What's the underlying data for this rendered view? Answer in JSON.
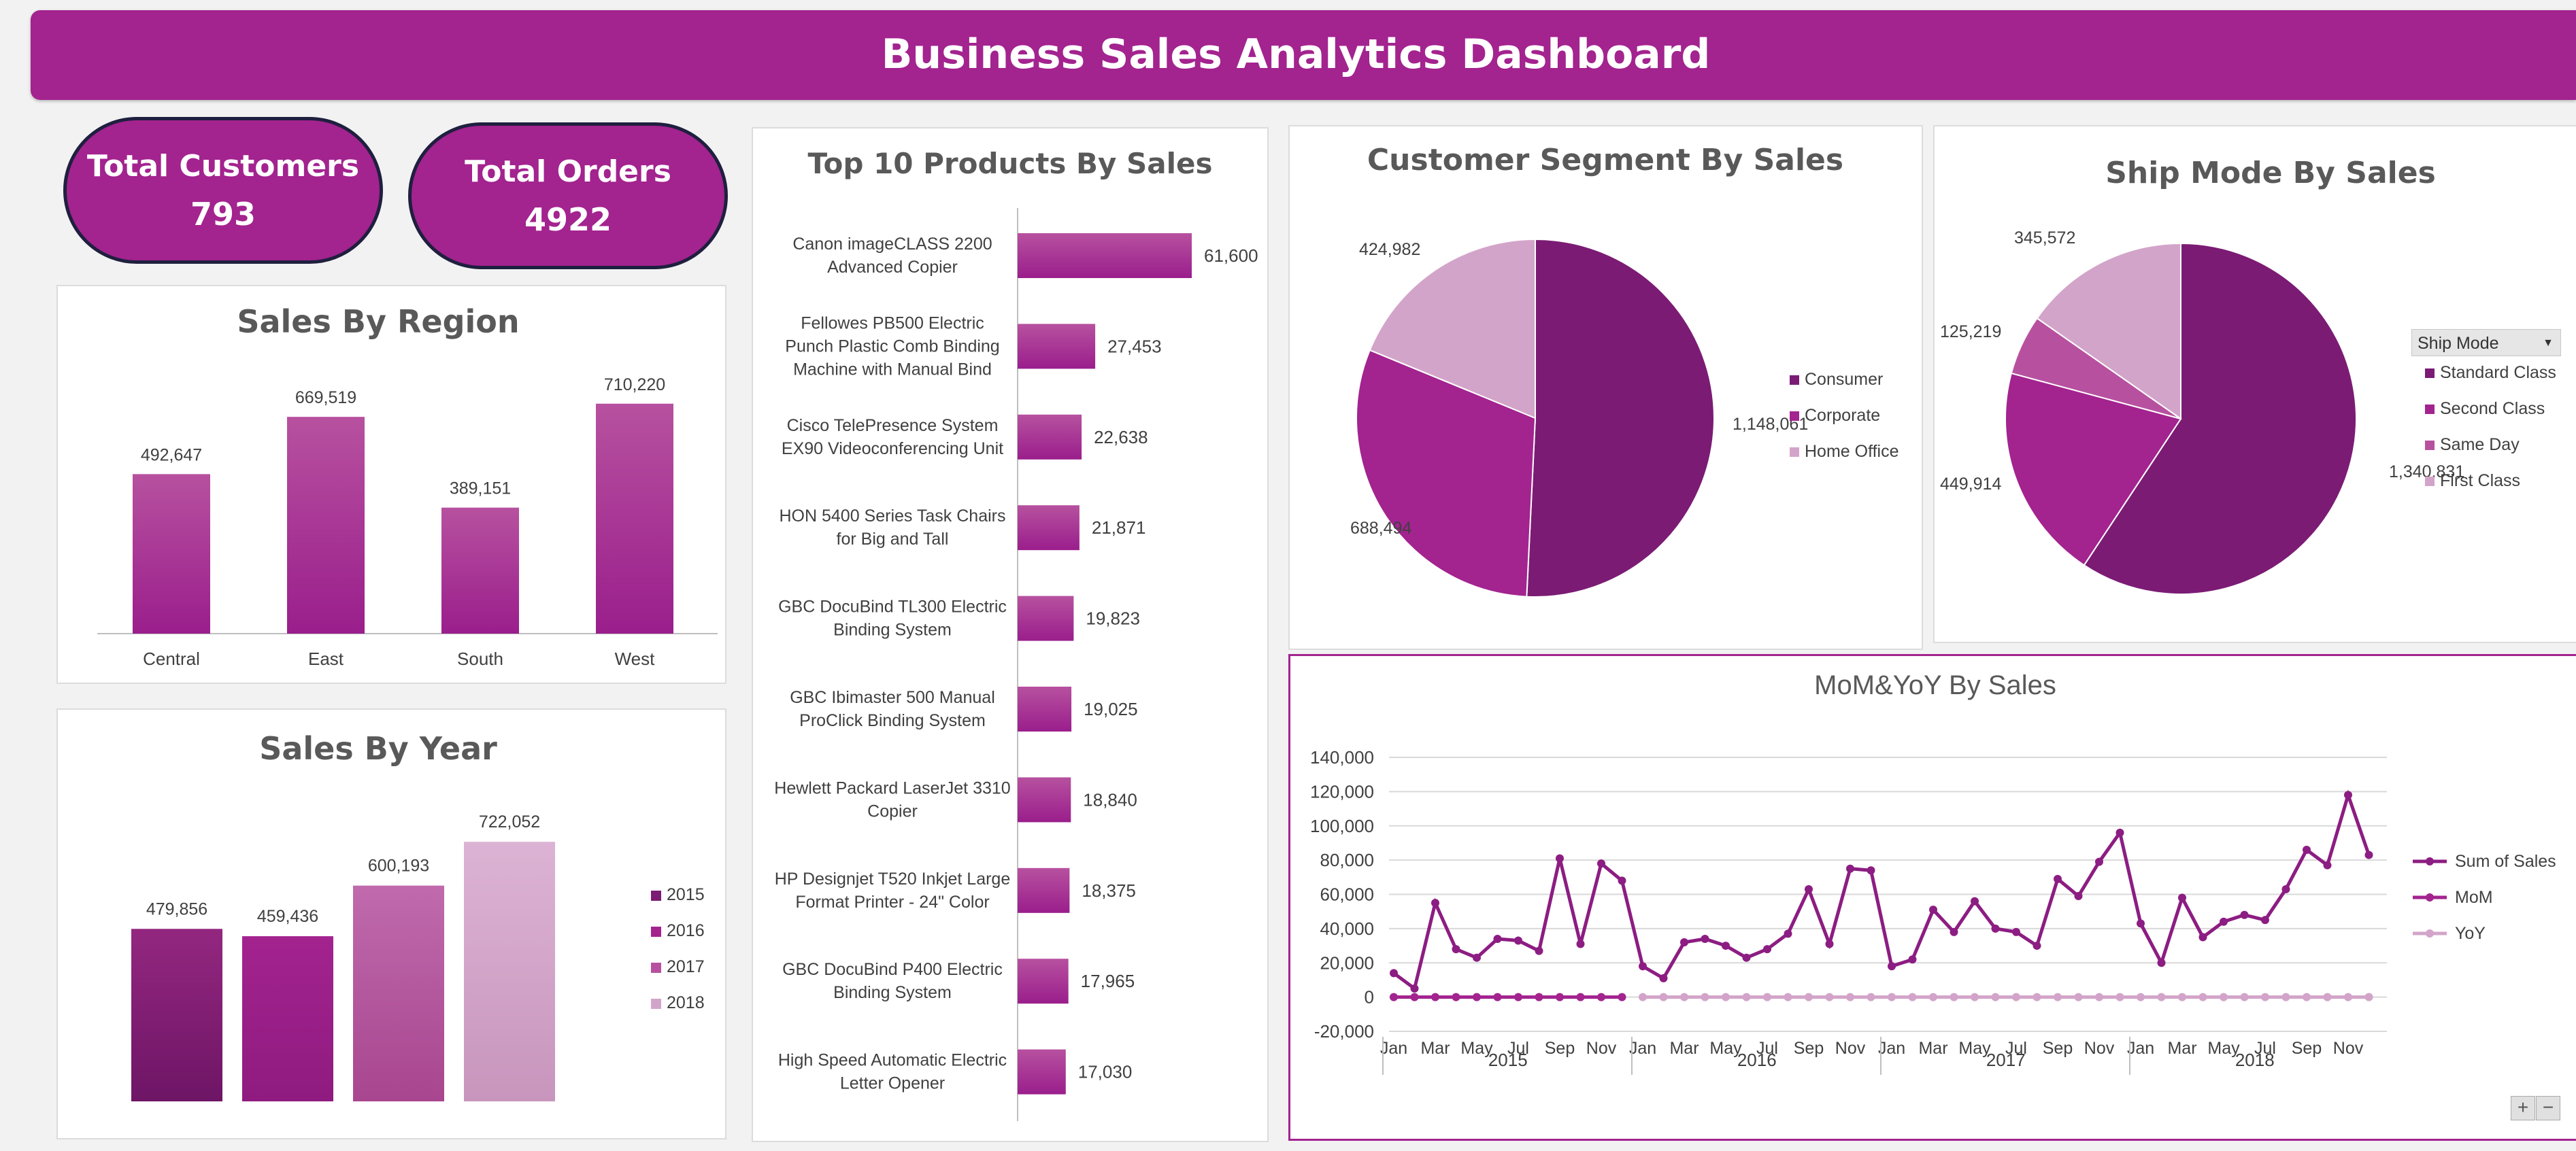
{
  "dashboard": {
    "title": "Business Sales Analytics Dashboard"
  },
  "kpis": {
    "customers": {
      "label": "Total Customers",
      "value": "793"
    },
    "orders": {
      "label": "Total Orders",
      "value": "4922"
    }
  },
  "colors": {
    "primary": "#a3238f",
    "dark": "#7b1b74",
    "medium": "#b7519f",
    "light": "#d3a4c9",
    "line": "#8c1d82"
  },
  "ship_filter": {
    "label": "Ship Mode"
  },
  "chart_data": [
    {
      "id": "region",
      "type": "bar",
      "title": "Sales By Region",
      "categories": [
        "Central",
        "East",
        "South",
        "West"
      ],
      "values": [
        492647,
        669519,
        389151,
        710220
      ],
      "value_labels": [
        "492,647",
        "669,519",
        "389,151",
        "710,220"
      ]
    },
    {
      "id": "year",
      "type": "bar",
      "title": "Sales By Year",
      "categories": [
        "2015",
        "2016",
        "2017",
        "2018"
      ],
      "values": [
        479856,
        459436,
        600193,
        722052
      ],
      "value_labels": [
        "479,856",
        "459,436",
        "600,193",
        "722,052"
      ],
      "legend": [
        "2015",
        "2016",
        "2017",
        "2018"
      ],
      "legend_position": "right"
    },
    {
      "id": "products",
      "type": "bar",
      "orientation": "horizontal",
      "title": "Top 10 Products By Sales",
      "categories": [
        "Canon imageCLASS 2200 Advanced Copier",
        "Fellowes PB500 Electric Punch Plastic Comb Binding Machine with Manual Bind",
        "Cisco TelePresence System EX90 Videoconferencing Unit",
        "HON 5400 Series Task Chairs for Big and Tall",
        "GBC DocuBind TL300 Electric Binding System",
        "GBC Ibimaster 500 Manual ProClick Binding System",
        "Hewlett Packard LaserJet 3310 Copier",
        "HP Designjet T520 Inkjet Large Format Printer - 24\" Color",
        "GBC DocuBind P400 Electric Binding System",
        "High Speed Automatic Electric Letter Opener"
      ],
      "category_lines": [
        [
          "Canon imageCLASS 2200",
          "Advanced Copier"
        ],
        [
          "Fellowes PB500 Electric",
          "Punch Plastic Comb Binding",
          "Machine with Manual Bind"
        ],
        [
          "Cisco TelePresence System",
          "EX90 Videoconferencing Unit"
        ],
        [
          "HON 5400 Series Task Chairs",
          "for Big and Tall"
        ],
        [
          "GBC DocuBind TL300 Electric",
          "Binding System"
        ],
        [
          "GBC Ibimaster 500 Manual",
          "ProClick Binding System"
        ],
        [
          "Hewlett Packard LaserJet 3310",
          "Copier"
        ],
        [
          "HP Designjet T520 Inkjet Large",
          "Format Printer - 24\" Color"
        ],
        [
          "GBC DocuBind P400 Electric",
          "Binding System"
        ],
        [
          "High Speed Automatic Electric",
          "Letter Opener"
        ]
      ],
      "values": [
        61600,
        27453,
        22638,
        21871,
        19823,
        19025,
        18840,
        18375,
        17965,
        17030
      ],
      "value_labels": [
        "61,600",
        "27,453",
        "22,638",
        "21,871",
        "19,823",
        "19,025",
        "18,840",
        "18,375",
        "17,965",
        "17,030"
      ]
    },
    {
      "id": "segment",
      "type": "pie",
      "title": "Customer Segment By Sales",
      "categories": [
        "Consumer",
        "Corporate",
        "Home Office"
      ],
      "values": [
        1148061,
        688494,
        424982
      ],
      "value_labels": [
        "1,148,061",
        "688,494",
        "424,982"
      ],
      "colors": [
        "#7b1b74",
        "#a3238f",
        "#d3a4c9"
      ],
      "legend_position": "right"
    },
    {
      "id": "shipmode",
      "type": "pie",
      "title": "Ship Mode By Sales",
      "categories": [
        "Standard Class",
        "Second Class",
        "Same Day",
        "First Class"
      ],
      "values": [
        1340831,
        449914,
        125219,
        345572
      ],
      "value_labels": [
        "1,340,831",
        "449,914",
        "125,219",
        "345,572"
      ],
      "colors": [
        "#7b1b74",
        "#a3238f",
        "#b7519f",
        "#d3a4c9"
      ],
      "legend_position": "right"
    },
    {
      "id": "trend",
      "type": "line",
      "title": "MoM&YoY By Sales",
      "month_ticks": [
        "Jan",
        "Mar",
        "May",
        "Jul",
        "Sep",
        "Nov"
      ],
      "years": [
        "2015",
        "2016",
        "2017",
        "2018"
      ],
      "y_ticks": [
        "140,000",
        "120,000",
        "100,000",
        "80,000",
        "60,000",
        "40,000",
        "20,000",
        "0",
        "-20,000"
      ],
      "ylim": [
        -20000,
        140000
      ],
      "grid": true,
      "legend_position": "right",
      "series": [
        {
          "name": "Sum of Sales",
          "values": [
            14000,
            5000,
            55000,
            28000,
            23000,
            34000,
            33000,
            27000,
            81000,
            31000,
            78000,
            68000,
            18000,
            11000,
            32000,
            34000,
            30000,
            23000,
            28000,
            37000,
            63000,
            31000,
            75000,
            74000,
            18000,
            22000,
            51000,
            38000,
            56000,
            40000,
            38000,
            30000,
            69000,
            59000,
            79000,
            96000,
            43000,
            20000,
            58000,
            35000,
            44000,
            48000,
            45000,
            63000,
            86000,
            77000,
            118000,
            83000
          ]
        },
        {
          "name": "MoM",
          "values": [
            0,
            0,
            0,
            0,
            0,
            0,
            0,
            0,
            0,
            0,
            0,
            0
          ]
        },
        {
          "name": "YoY",
          "values": [
            0,
            0,
            0,
            0,
            0,
            0,
            0,
            0,
            0,
            0,
            0,
            0,
            0,
            0,
            0,
            0,
            0,
            0,
            0,
            0,
            0,
            0,
            0,
            0,
            0,
            0,
            0,
            0,
            0,
            0,
            0,
            0,
            0,
            0,
            0,
            0,
            0,
            0,
            0,
            0,
            0,
            0,
            0,
            0,
            0,
            0,
            0,
            0
          ]
        }
      ]
    }
  ]
}
